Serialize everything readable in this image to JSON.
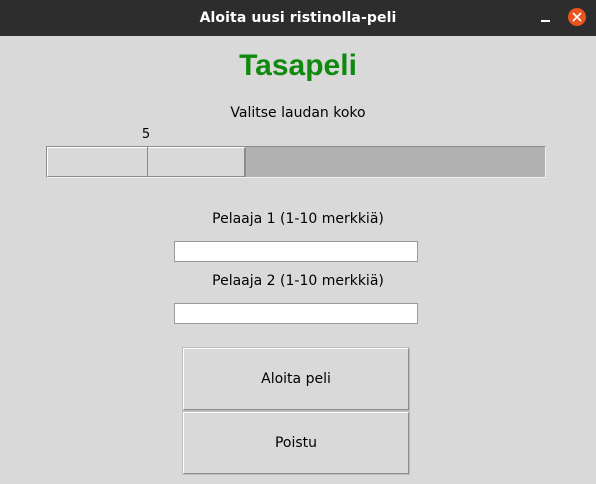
{
  "window": {
    "title": "Aloita uusi ristinolla-peli",
    "close_glyph": "✕"
  },
  "content": {
    "result_heading": "Tasapeli",
    "result_color": "#0f8a0f",
    "board_size_label": "Valitse laudan koko",
    "board_size_value": "5",
    "board_size_fraction": 0.4,
    "player1_label": "Pelaaja 1 (1-10 merkkiä)",
    "player1_value": "",
    "player2_label": "Pelaaja 2 (1-10 merkkiä)",
    "player2_value": "",
    "start_button": "Aloita peli",
    "quit_button": "Poistu"
  },
  "colors": {
    "titlebar": "#2d2d2d",
    "close_button": "#e9541f",
    "background": "#d9d9d9"
  }
}
